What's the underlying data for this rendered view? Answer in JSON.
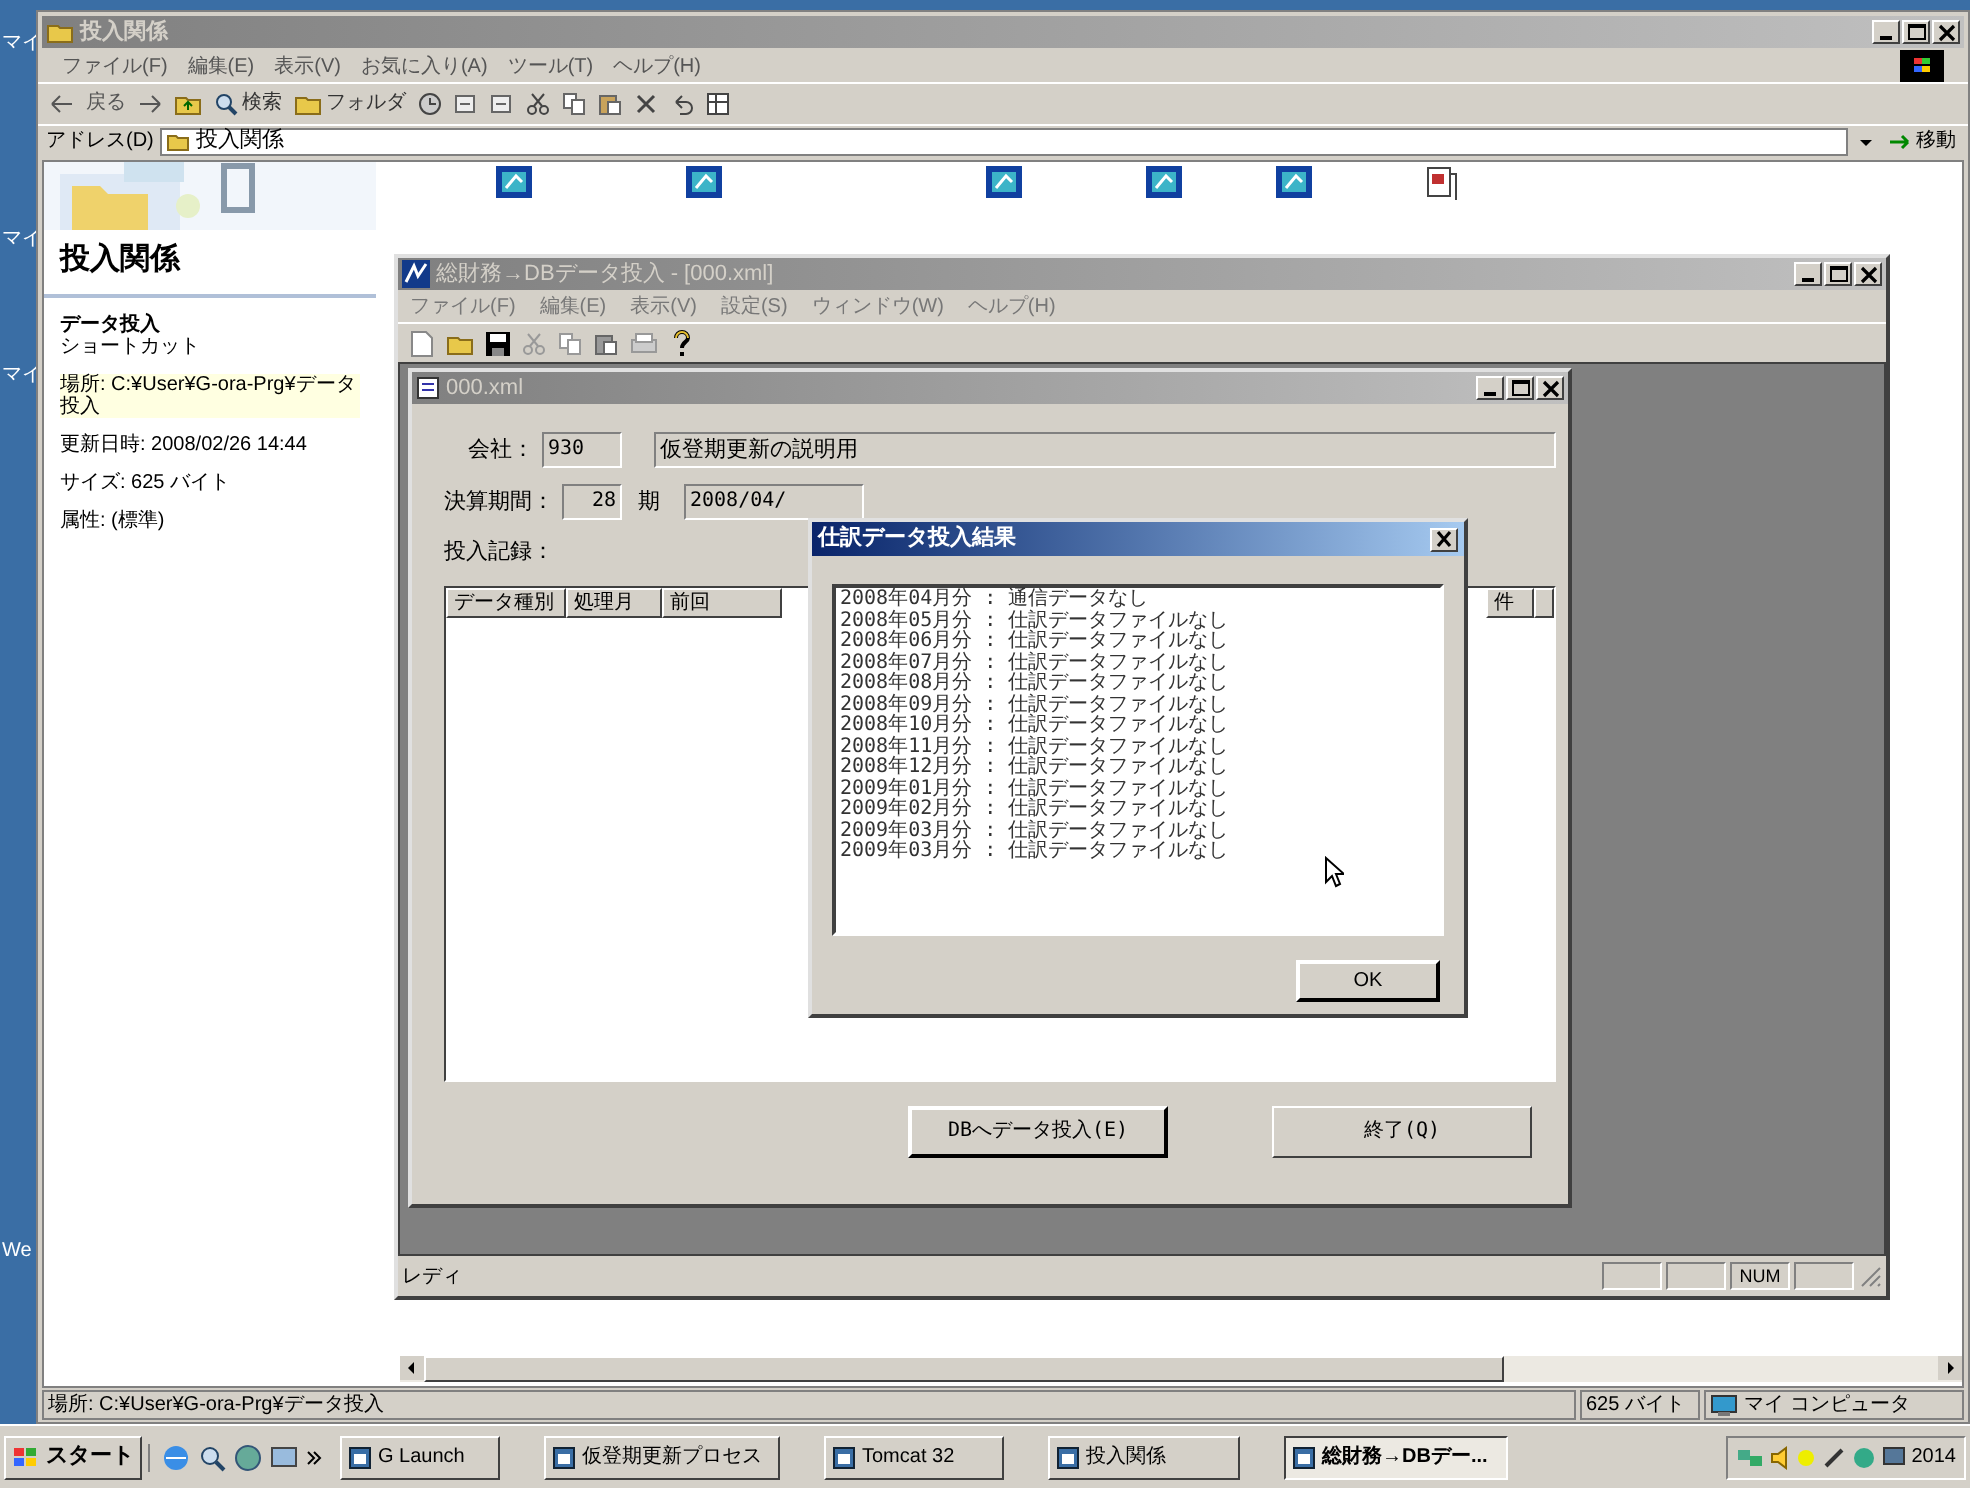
{
  "desktop_labels": [
    "マイ",
    "マイ",
    "マイ",
    "We"
  ],
  "explorer": {
    "title": "投入関係",
    "menu": [
      "ファイル(F)",
      "編集(E)",
      "表示(V)",
      "お気に入り(A)",
      "ツール(T)",
      "ヘルプ(H)"
    ],
    "toolbar": {
      "back": "戻る",
      "search": "検索",
      "folders": "フォルダ"
    },
    "address": {
      "label": "アドレス(D)",
      "value": "投入関係",
      "go": "移動"
    },
    "panel": {
      "title": "投入関係",
      "item_name": "データ投入",
      "item_type": "ショートカット",
      "details": [
        "場所: C:¥User¥G-ora-Prg¥データ投入",
        "更新日時: 2008/02/26 14:44",
        "サイズ: 625 バイト",
        "属性: (標準)"
      ]
    },
    "status": {
      "location": "場所: C:¥User¥G-ora-Prg¥データ投入",
      "size": "625 バイト",
      "zone": "マイ コンピュータ"
    }
  },
  "app": {
    "title": "総財務→DBデータ投入 - [000.xml]",
    "menu": [
      "ファイル(F)",
      "編集(E)",
      "表示(V)",
      "設定(S)",
      "ウィンドウ(W)",
      "ヘルプ(H)"
    ],
    "child": {
      "title": "000.xml",
      "company_label": "会社：",
      "company_code": "930",
      "company_name": "仮登期更新の説明用",
      "period_label": "決算期間：",
      "period": "28",
      "period_unit": "期",
      "date": "2008/04/",
      "record_label": "投入記録：",
      "columns": [
        "データ種別",
        "処理月",
        "前回",
        "件"
      ],
      "buttons": [
        "DBへデータ投入(E)",
        "終了(Q)"
      ]
    },
    "status": {
      "text": "レディ",
      "indicator": "NUM"
    }
  },
  "dialog": {
    "title": "仕訳データ投入結果",
    "lines": [
      "2008年04月分 : 通信データなし",
      "2008年05月分 : 仕訳データファイルなし",
      "2008年06月分 : 仕訳データファイルなし",
      "2008年07月分 : 仕訳データファイルなし",
      "2008年08月分 : 仕訳データファイルなし",
      "2008年09月分 : 仕訳データファイルなし",
      "2008年10月分 : 仕訳データファイルなし",
      "2008年11月分 : 仕訳データファイルなし",
      "2008年12月分 : 仕訳データファイルなし",
      "2009年01月分 : 仕訳データファイルなし",
      "2009年02月分 : 仕訳データファイルなし",
      "2009年03月分 : 仕訳データファイルなし",
      "2009年03月分 : 仕訳データファイルなし"
    ],
    "button": "OK"
  },
  "taskbar": {
    "start": "スタート",
    "tasks": [
      {
        "label": "G Launch",
        "selected": false
      },
      {
        "label": "仮登期更新プロセス",
        "selected": false
      },
      {
        "label": "Tomcat 32",
        "selected": false
      },
      {
        "label": "投入関係",
        "selected": false
      },
      {
        "label": "総財務→DBデー...",
        "selected": true
      }
    ],
    "clock": "2014"
  }
}
